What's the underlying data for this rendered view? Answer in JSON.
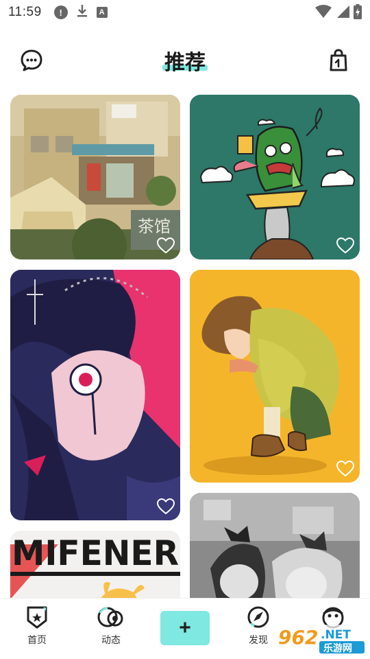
{
  "status_bar": {
    "time": "11:59",
    "left_icons": [
      "alert-icon",
      "download-icon",
      "text-a-icon"
    ],
    "alert_glyph": "!",
    "a_glyph": "A",
    "right_icons": [
      "wifi-icon",
      "signal-icon",
      "battery-icon"
    ]
  },
  "header": {
    "title": "推荐",
    "left_icon": "chat-bubble-icon",
    "right_icon": "shopping-bag-icon",
    "accent_color": "#7fe8e0"
  },
  "feed": {
    "cards": [
      {
        "column": "left",
        "subject": "street-scene",
        "sign_text": "茶馆",
        "liked": false
      },
      {
        "column": "right",
        "subject": "pickle-monster",
        "liked": false
      },
      {
        "column": "left",
        "subject": "gothic-girl",
        "liked": false
      },
      {
        "column": "right",
        "subject": "crouching-boy",
        "liked": false
      },
      {
        "column": "left",
        "subject": "mifener-poster",
        "caption": "MIFENER",
        "liked": false
      },
      {
        "column": "right",
        "subject": "grayscale-girls",
        "liked": false
      }
    ]
  },
  "bottom_nav": {
    "items": [
      {
        "label": "首页",
        "icon": "home-badge-icon"
      },
      {
        "label": "动态",
        "icon": "activity-icon"
      },
      {
        "label": "",
        "icon": "plus-icon"
      },
      {
        "label": "发现",
        "icon": "discover-icon"
      },
      {
        "label": "",
        "icon": "profile-icon"
      }
    ],
    "add_symbol": "+"
  },
  "watermark": {
    "number": "962",
    "domain": ".NET",
    "site": "乐游网"
  }
}
